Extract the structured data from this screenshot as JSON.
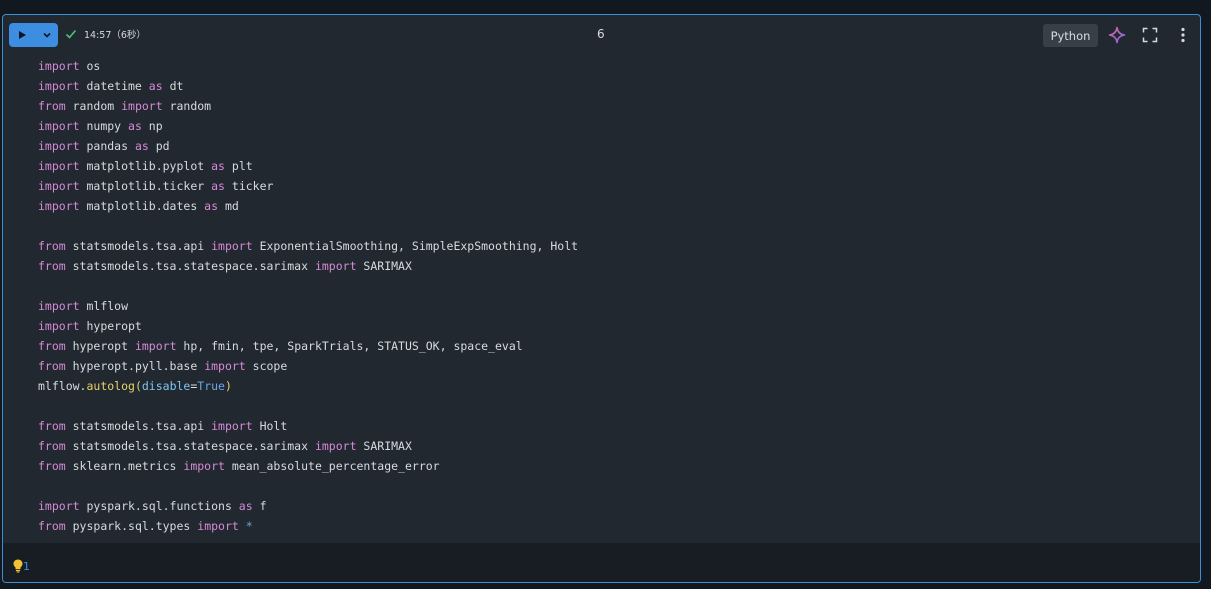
{
  "header": {
    "status_time": "14:57",
    "status_duration": "（6秒）",
    "cell_number": "6",
    "language": "Python"
  },
  "icons": {
    "run": "play-icon",
    "dropdown": "chevron-down-icon",
    "success": "check-icon",
    "assistant": "sparkle-icon",
    "expand": "expand-icon",
    "more": "more-vertical-icon",
    "hint": "lightbulb-icon"
  },
  "colors": {
    "accent": "#3d8ee0",
    "success": "#4ec27a",
    "keyword": "#d68ad6",
    "function": "#e6d36a",
    "assistant_start": "#e0609a",
    "assistant_end": "#7a6ee8",
    "hint": "#f2c233"
  },
  "code_lines": [
    [
      {
        "t": "import",
        "k": "kw"
      },
      {
        "t": " os"
      }
    ],
    [
      {
        "t": "import",
        "k": "kw"
      },
      {
        "t": " datetime "
      },
      {
        "t": "as",
        "k": "kw"
      },
      {
        "t": " dt"
      }
    ],
    [
      {
        "t": "from",
        "k": "kw"
      },
      {
        "t": " random "
      },
      {
        "t": "import",
        "k": "kw"
      },
      {
        "t": " random"
      }
    ],
    [
      {
        "t": "import",
        "k": "kw"
      },
      {
        "t": " numpy "
      },
      {
        "t": "as",
        "k": "kw"
      },
      {
        "t": " np"
      }
    ],
    [
      {
        "t": "import",
        "k": "kw"
      },
      {
        "t": " pandas "
      },
      {
        "t": "as",
        "k": "kw"
      },
      {
        "t": " pd"
      }
    ],
    [
      {
        "t": "import",
        "k": "kw"
      },
      {
        "t": " matplotlib.pyplot "
      },
      {
        "t": "as",
        "k": "kw"
      },
      {
        "t": " plt"
      }
    ],
    [
      {
        "t": "import",
        "k": "kw"
      },
      {
        "t": " matplotlib.ticker "
      },
      {
        "t": "as",
        "k": "kw"
      },
      {
        "t": " ticker"
      }
    ],
    [
      {
        "t": "import",
        "k": "kw"
      },
      {
        "t": " matplotlib.dates "
      },
      {
        "t": "as",
        "k": "kw"
      },
      {
        "t": " md"
      }
    ],
    [],
    [
      {
        "t": "from",
        "k": "kw"
      },
      {
        "t": " statsmodels.tsa.api "
      },
      {
        "t": "import",
        "k": "kw"
      },
      {
        "t": " ExponentialSmoothing, SimpleExpSmoothing, Holt"
      }
    ],
    [
      {
        "t": "from",
        "k": "kw"
      },
      {
        "t": " statsmodels.tsa.statespace.sarimax "
      },
      {
        "t": "import",
        "k": "kw"
      },
      {
        "t": " SARIMAX"
      }
    ],
    [],
    [
      {
        "t": "import",
        "k": "kw"
      },
      {
        "t": " mlflow"
      }
    ],
    [
      {
        "t": "import",
        "k": "kw"
      },
      {
        "t": " hyperopt"
      }
    ],
    [
      {
        "t": "from",
        "k": "kw"
      },
      {
        "t": " hyperopt "
      },
      {
        "t": "import",
        "k": "kw"
      },
      {
        "t": " hp, fmin, tpe, SparkTrials, STATUS_OK, space_eval"
      }
    ],
    [
      {
        "t": "from",
        "k": "kw"
      },
      {
        "t": " hyperopt.pyll.base "
      },
      {
        "t": "import",
        "k": "kw"
      },
      {
        "t": " scope"
      }
    ],
    [
      {
        "t": "mlflow."
      },
      {
        "t": "autolog",
        "k": "fn"
      },
      {
        "t": "(",
        "k": "fn"
      },
      {
        "t": "disable",
        "k": "param"
      },
      {
        "t": "="
      },
      {
        "t": "True",
        "k": "const"
      },
      {
        "t": ")",
        "k": "fn"
      }
    ],
    [],
    [
      {
        "t": "from",
        "k": "kw"
      },
      {
        "t": " statsmodels.tsa.api "
      },
      {
        "t": "import",
        "k": "kw"
      },
      {
        "t": " Holt"
      }
    ],
    [
      {
        "t": "from",
        "k": "kw"
      },
      {
        "t": " statsmodels.tsa.statespace.sarimax "
      },
      {
        "t": "import",
        "k": "kw"
      },
      {
        "t": " SARIMAX"
      }
    ],
    [
      {
        "t": "from",
        "k": "kw"
      },
      {
        "t": " sklearn.metrics "
      },
      {
        "t": "import",
        "k": "kw"
      },
      {
        "t": " mean_absolute_percentage_error"
      }
    ],
    [],
    [
      {
        "t": "import",
        "k": "kw"
      },
      {
        "t": " pyspark.sql.functions "
      },
      {
        "t": "as",
        "k": "kw"
      },
      {
        "t": " f"
      }
    ],
    [
      {
        "t": "from",
        "k": "kw"
      },
      {
        "t": " pyspark.sql.types "
      },
      {
        "t": "import",
        "k": "kw"
      },
      {
        "t": " "
      },
      {
        "t": "*",
        "k": "const"
      }
    ]
  ],
  "footer": {
    "hint_count": "1"
  }
}
